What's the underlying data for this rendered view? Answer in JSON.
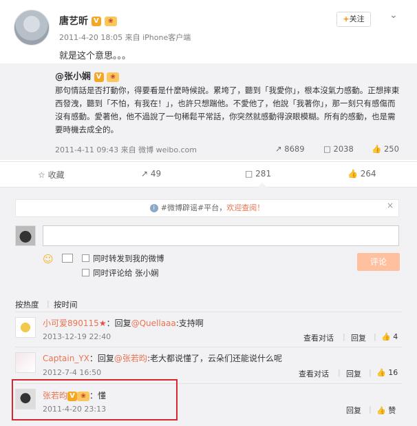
{
  "post": {
    "author": "唐艺昕",
    "vbadge": "V",
    "vipbadge": "",
    "meta": "2011-4-20 18:05 来自 iPhone客户端",
    "text": "就是这个意思。。。",
    "follow_label": "关注",
    "follow_plus": "+",
    "menu_icon": "chevron-down-icon"
  },
  "repost": {
    "author": "@张小娴",
    "text": "那句情話是否打動你，得要看是什麼時候說。累垮了，聽到「我愛你」，根本沒氣力感動。正想摔東西發洩，聽到「不怕，有我在！」，也許只想踹他。不愛他了，他說「我著你」，那一刻只有感傷而沒有感動。愛著他，他不過說了一句稀鬆平常話，你突然就感動得淚眼模糊。所有的感動，也是需要時機去成全的。",
    "meta": "2011-4-11 09:43 来自 微博 weibo.com",
    "reposts": "8689",
    "comments": "2038",
    "likes": "250"
  },
  "actions": {
    "favorite": "收藏",
    "repost": "49",
    "comment": "281",
    "like": "264"
  },
  "notice": {
    "prefix": "#微博辟谣#平台，",
    "highlight": "欢迎查阅！",
    "close": "×"
  },
  "composer": {
    "placeholder": "",
    "repost_to_my_weibo": "同时转发到我的微博",
    "comment_to": "同时评论给 张小娴",
    "submit": "评论"
  },
  "sort": {
    "by_hot": "按热度",
    "by_time": "按时间"
  },
  "comments": [
    {
      "user": "小可爱890115",
      "text_prefix": "：回复",
      "mention": "@Quellaaa",
      "text": ":支持啊",
      "time": "2013-12-19 22:40",
      "view_thread": "查看对话",
      "reply": "回复",
      "likes": "4"
    },
    {
      "user": "Captain_YX",
      "text_prefix": "：回复",
      "mention": "@张若昀",
      "text": ":老大都说懂了，云朵们还能说什么呢",
      "time": "2012-7-4 16:50",
      "view_thread": "查看对话",
      "reply": "回复",
      "likes": "16"
    },
    {
      "user": "张若昀",
      "text": "：懂",
      "time": "2011-4-20 23:13",
      "reply": "回复",
      "likes": "赞"
    }
  ]
}
